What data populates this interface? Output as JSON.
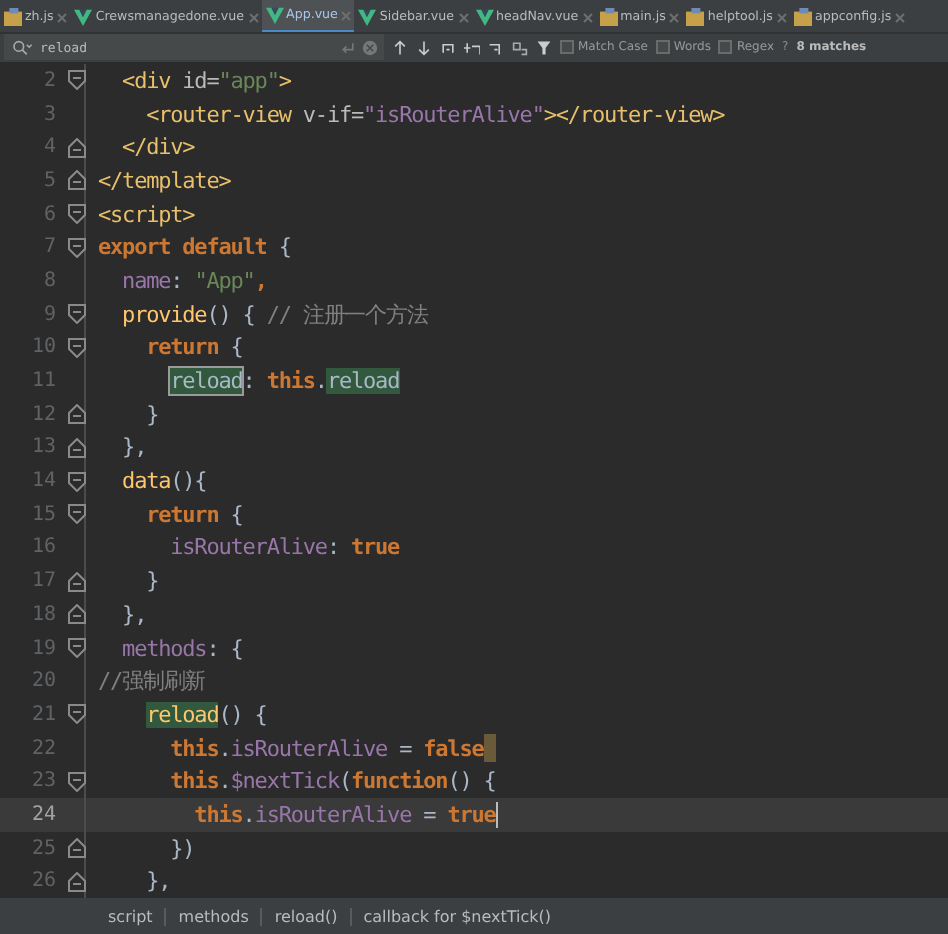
{
  "tabs": [
    {
      "label": "zh.js",
      "kind": "js",
      "selected": false
    },
    {
      "label": "Crewsmanagedone.vue",
      "kind": "vue",
      "selected": false
    },
    {
      "label": "App.vue",
      "kind": "vue",
      "selected": true
    },
    {
      "label": "Sidebar.vue",
      "kind": "vue",
      "selected": false
    },
    {
      "label": "headNav.vue",
      "kind": "vue",
      "selected": false
    },
    {
      "label": "main.js",
      "kind": "js",
      "selected": false
    },
    {
      "label": "helptool.js",
      "kind": "js",
      "selected": false
    },
    {
      "label": "appconfig.js",
      "kind": "js",
      "selected": false
    }
  ],
  "search": {
    "value": "reload",
    "options": [
      {
        "label": "Match Case",
        "checked": false
      },
      {
        "label": "Words",
        "checked": false
      },
      {
        "label": "Regex",
        "checked": false
      }
    ],
    "help": "?",
    "matches": "8 matches"
  },
  "lines": [
    {
      "number": "2",
      "fold_start": true,
      "fold_end": false,
      "tokens": [
        {
          "text": "  <div",
          "kind": "tag"
        },
        {
          "text": " id=",
          "kind": "attr"
        },
        {
          "text": "\"app\"",
          "kind": "string"
        },
        {
          "text": ">",
          "kind": "tag"
        }
      ]
    },
    {
      "number": "3",
      "fold_start": false,
      "fold_end": false,
      "tokens": [
        {
          "text": "    <router-view",
          "kind": "tag"
        },
        {
          "text": " v-if=",
          "kind": "attr"
        },
        {
          "text": "\"isRouterAlive\"",
          "kind": "expr"
        },
        {
          "text": "></router-view>",
          "kind": "tag"
        }
      ]
    },
    {
      "number": "4",
      "fold_start": false,
      "fold_end": true,
      "tokens": [
        {
          "text": "  </div>",
          "kind": "tag"
        }
      ]
    },
    {
      "number": "5",
      "fold_start": false,
      "fold_end": true,
      "tokens": [
        {
          "text": "</template>",
          "kind": "tag"
        }
      ]
    },
    {
      "number": "6",
      "fold_start": true,
      "fold_end": false,
      "tokens": [
        {
          "text": "<script>",
          "kind": "tag"
        }
      ]
    },
    {
      "number": "7",
      "fold_start": true,
      "fold_end": false,
      "tokens": [
        {
          "text": "export default",
          "kind": "keyword"
        },
        {
          "text": " {",
          "kind": "plain"
        }
      ]
    },
    {
      "number": "8",
      "fold_start": false,
      "fold_end": false,
      "tokens": [
        {
          "text": "  name",
          "kind": "prop"
        },
        {
          "text": ": ",
          "kind": "plain"
        },
        {
          "text": "\"App\"",
          "kind": "string"
        },
        {
          "text": ",",
          "kind": "keyword"
        }
      ]
    },
    {
      "number": "9",
      "fold_start": true,
      "fold_end": false,
      "tokens": [
        {
          "text": "  provide",
          "kind": "func"
        },
        {
          "text": "() { ",
          "kind": "plain"
        },
        {
          "text": "// 注册一个方法",
          "kind": "comment"
        }
      ]
    },
    {
      "number": "10",
      "fold_start": true,
      "fold_end": false,
      "tokens": [
        {
          "text": "    return",
          "kind": "keyword"
        },
        {
          "text": " {",
          "kind": "plain"
        }
      ]
    },
    {
      "number": "11",
      "fold_start": false,
      "fold_end": false,
      "tokens": [
        {
          "text": "      reload",
          "kind": "plain",
          "found": true,
          "selected": true
        },
        {
          "text": ": ",
          "kind": "plain"
        },
        {
          "text": "this",
          "kind": "keyword"
        },
        {
          "text": ".",
          "kind": "plain"
        },
        {
          "text": "reload",
          "kind": "plain",
          "found": true,
          "selected": false
        }
      ]
    },
    {
      "number": "12",
      "fold_start": false,
      "fold_end": true,
      "tokens": [
        {
          "text": "    }",
          "kind": "plain"
        }
      ]
    },
    {
      "number": "13",
      "fold_start": false,
      "fold_end": true,
      "tokens": [
        {
          "text": "  },",
          "kind": "plain"
        }
      ]
    },
    {
      "number": "14",
      "fold_start": true,
      "fold_end": false,
      "tokens": [
        {
          "text": "  data",
          "kind": "func"
        },
        {
          "text": "(){",
          "kind": "plain"
        }
      ]
    },
    {
      "number": "15",
      "fold_start": true,
      "fold_end": false,
      "tokens": [
        {
          "text": "    return",
          "kind": "keyword"
        },
        {
          "text": " {",
          "kind": "plain"
        }
      ]
    },
    {
      "number": "16",
      "fold_start": false,
      "fold_end": false,
      "tokens": [
        {
          "text": "      isRouterAlive",
          "kind": "prop"
        },
        {
          "text": ": ",
          "kind": "plain"
        },
        {
          "text": "true",
          "kind": "keyword"
        }
      ]
    },
    {
      "number": "17",
      "fold_start": false,
      "fold_end": true,
      "tokens": [
        {
          "text": "    }",
          "kind": "plain"
        }
      ]
    },
    {
      "number": "18",
      "fold_start": false,
      "fold_end": true,
      "tokens": [
        {
          "text": "  },",
          "kind": "plain"
        }
      ]
    },
    {
      "number": "19",
      "fold_start": true,
      "fold_end": false,
      "tokens": [
        {
          "text": "  methods",
          "kind": "prop"
        },
        {
          "text": ": {",
          "kind": "plain"
        }
      ]
    },
    {
      "number": "20",
      "fold_start": false,
      "fold_end": false,
      "tokens": [
        {
          "text": "//强制刷新",
          "kind": "comment"
        }
      ]
    },
    {
      "number": "21",
      "fold_start": true,
      "fold_end": false,
      "tokens": [
        {
          "text": "    reload",
          "kind": "func",
          "found": true,
          "selected": false
        },
        {
          "text": "() {",
          "kind": "plain"
        }
      ]
    },
    {
      "number": "22",
      "fold_start": false,
      "fold_end": false,
      "brace_marker": true,
      "tokens": [
        {
          "text": "      this",
          "kind": "keyword"
        },
        {
          "text": ".",
          "kind": "plain"
        },
        {
          "text": "isRouterAlive",
          "kind": "prop"
        },
        {
          "text": " = ",
          "kind": "plain"
        },
        {
          "text": "false",
          "kind": "keyword"
        }
      ]
    },
    {
      "number": "23",
      "fold_start": true,
      "fold_end": false,
      "tokens": [
        {
          "text": "      this",
          "kind": "keyword"
        },
        {
          "text": ".",
          "kind": "plain"
        },
        {
          "text": "$nextTick",
          "kind": "prop"
        },
        {
          "text": "(",
          "kind": "plain"
        },
        {
          "text": "function",
          "kind": "keyword"
        },
        {
          "text": "() {",
          "kind": "plain"
        }
      ]
    },
    {
      "number": "24",
      "fold_start": false,
      "fold_end": false,
      "current": true,
      "cursor": true,
      "tokens": [
        {
          "text": "        this",
          "kind": "keyword"
        },
        {
          "text": ".",
          "kind": "plain"
        },
        {
          "text": "isRouterAlive",
          "kind": "prop"
        },
        {
          "text": " = ",
          "kind": "plain"
        },
        {
          "text": "true",
          "kind": "keyword"
        }
      ]
    },
    {
      "number": "25",
      "fold_start": false,
      "fold_end": true,
      "tokens": [
        {
          "text": "      })",
          "kind": "plain"
        }
      ]
    },
    {
      "number": "26",
      "fold_start": false,
      "fold_end": true,
      "tokens": [
        {
          "text": "    },",
          "kind": "plain"
        }
      ]
    }
  ],
  "breadcrumbs": [
    "script",
    "methods",
    "reload()",
    "callback for $nextTick()"
  ]
}
